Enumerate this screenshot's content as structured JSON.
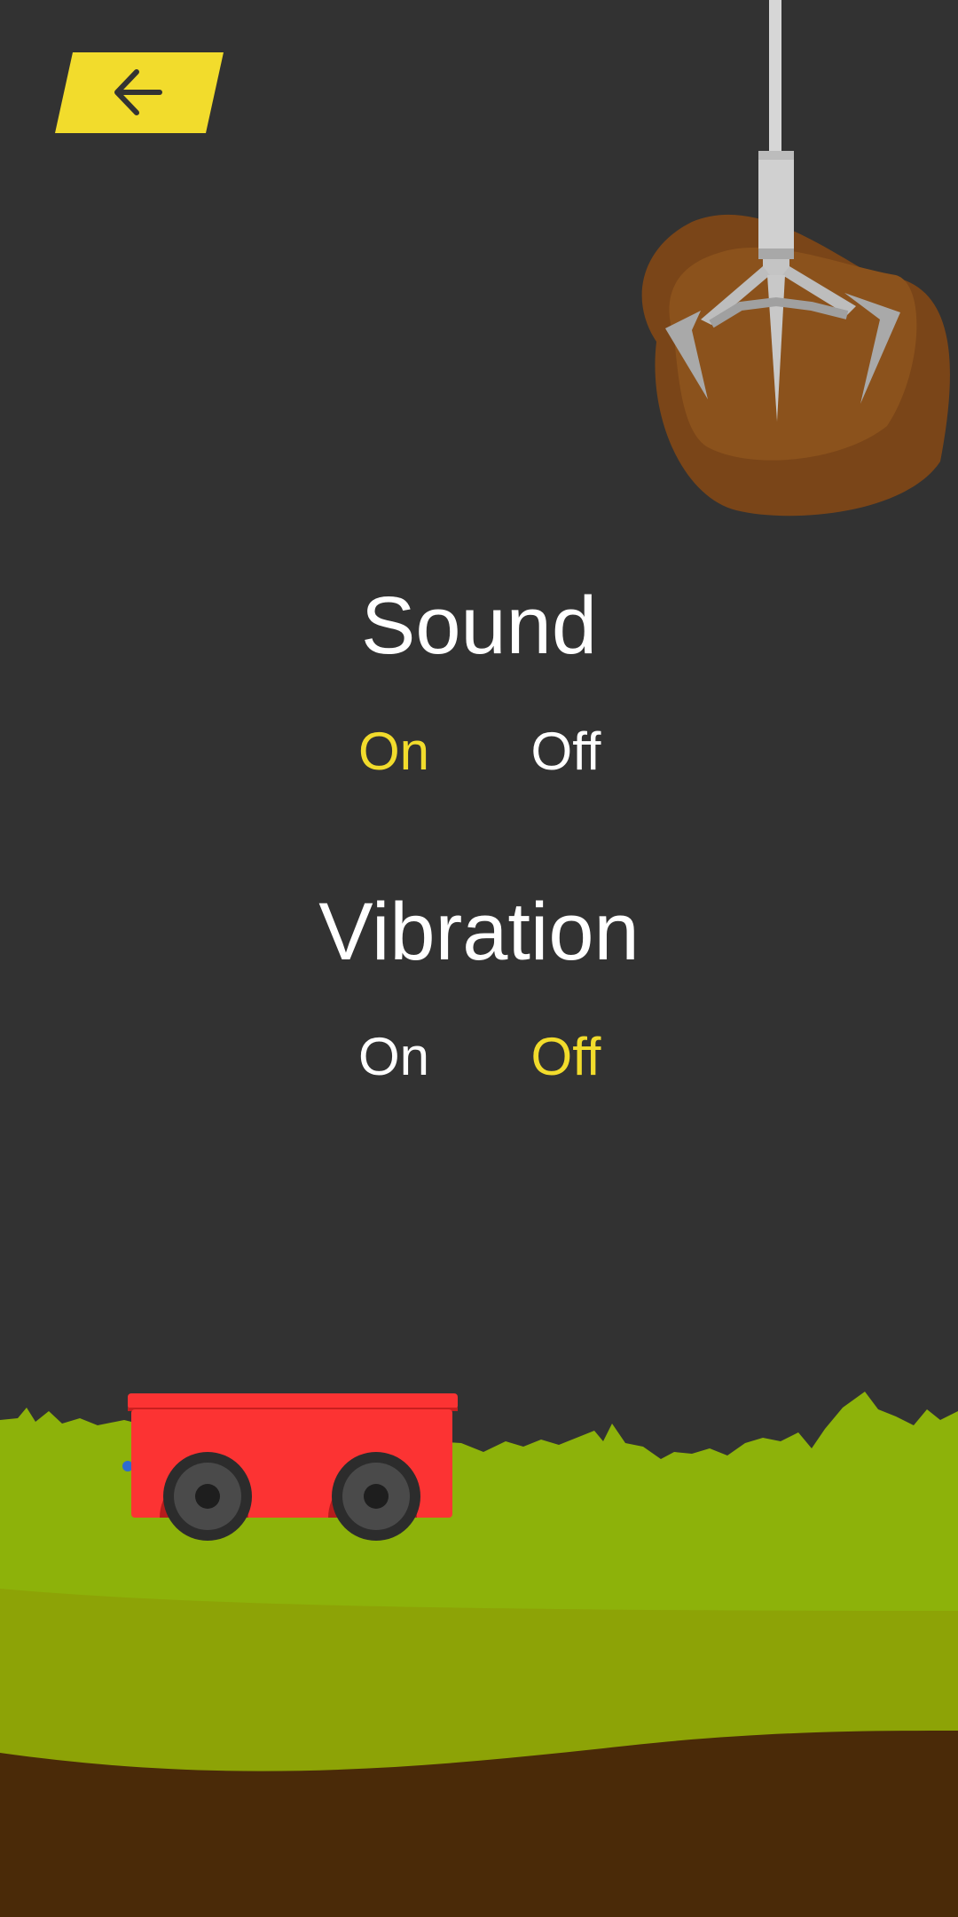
{
  "back_button": {
    "icon": "arrow-left-icon",
    "color": "#f2dc2c"
  },
  "settings": {
    "sound": {
      "title": "Sound",
      "on_label": "On",
      "off_label": "Off",
      "selected": "On"
    },
    "vibration": {
      "title": "Vibration",
      "on_label": "On",
      "off_label": "Off",
      "selected": "Off"
    }
  },
  "colors": {
    "background": "#323232",
    "accent": "#f2dc2c",
    "text": "#ffffff",
    "grass": "#8db20a",
    "soil": "#4a2a08",
    "cart": "#fc3333",
    "rock": "#8b521c"
  },
  "decor": {
    "claw": "claw-icon",
    "rock": "rock-icon",
    "cart": "mine-cart-icon"
  }
}
